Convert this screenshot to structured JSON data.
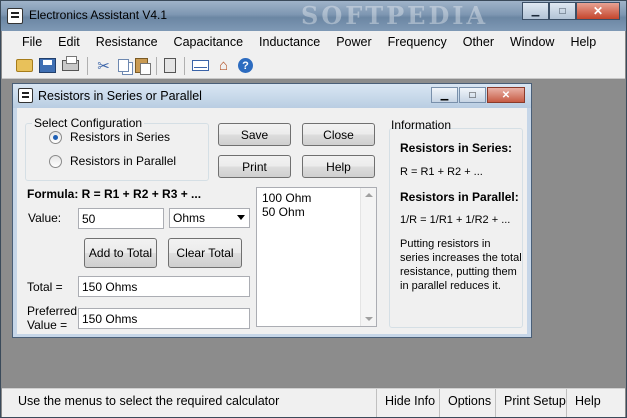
{
  "window": {
    "title": "Electronics Assistant V4.1",
    "watermark": "SOFTPEDIA",
    "minimize": "▁",
    "maximize": "□",
    "close": "✕"
  },
  "menu": [
    "File",
    "Edit",
    "Resistance",
    "Capacitance",
    "Inductance",
    "Power",
    "Frequency",
    "Other",
    "Window",
    "Help"
  ],
  "toolbar": {
    "icons": [
      "open-folder-icon",
      "save-icon",
      "print-icon",
      "cut-icon",
      "copy-icon",
      "paste-icon",
      "calculator-icon",
      "email-icon",
      "home-icon",
      "help-icon"
    ],
    "cut_glyph": "✂",
    "home_glyph": "⌂",
    "help_glyph": "?"
  },
  "dialog": {
    "title": "Resistors in Series or Parallel",
    "config": {
      "legend": "Select Configuration",
      "options": [
        "Resistors in Series",
        "Resistors in Parallel"
      ],
      "selected": "Resistors in Series"
    },
    "buttons": {
      "save": "Save",
      "close": "Close",
      "print": "Print",
      "help": "Help",
      "add": "Add to Total",
      "clear": "Clear Total"
    },
    "formula": "Formula: R = R1 + R2 + R3 + ...",
    "value_label": "Value:",
    "value": "50",
    "unit": "Ohms",
    "total_label": "Total =",
    "total": "150 Ohms",
    "preferred_label_1": "Preferred",
    "preferred_label_2": "Value =",
    "preferred": "150 Ohms",
    "list_items": [
      "100 Ohm",
      "50 Ohm"
    ],
    "info": {
      "legend": "Information",
      "series_heading": "Resistors in Series:",
      "series_formula": "R = R1 + R2 + ...",
      "parallel_heading": "Resistors in Parallel:",
      "parallel_formula": "1/R = 1/R1 + 1/R2 + ...",
      "note": "Putting resistors in series increases the total resistance, putting them in parallel reduces it."
    }
  },
  "status": {
    "message": "Use the menus to select the required calculator",
    "items": [
      "Hide Info",
      "Options",
      "Print Setup",
      "Help"
    ]
  }
}
